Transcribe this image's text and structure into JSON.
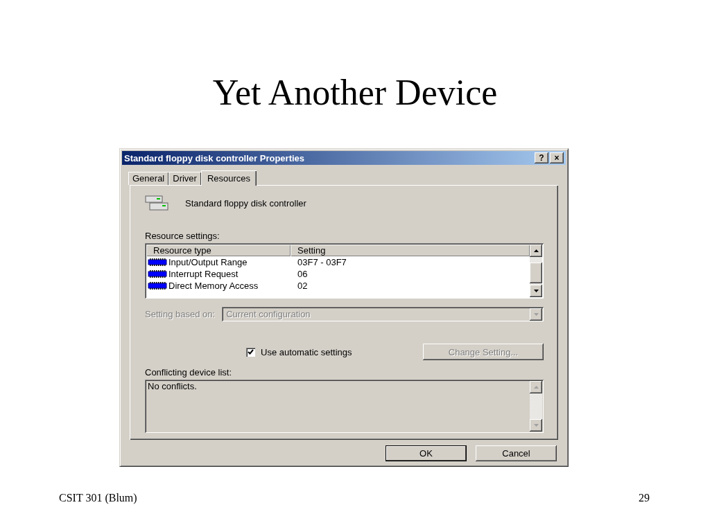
{
  "slide": {
    "title": "Yet Another Device",
    "footer_left": "CSIT 301 (Blum)",
    "page_number": "29"
  },
  "window": {
    "title": "Standard floppy disk controller Properties",
    "title_buttons": [
      "?",
      "×"
    ]
  },
  "tabs": [
    {
      "label": "General",
      "selected": false
    },
    {
      "label": "Driver",
      "selected": false
    },
    {
      "label": "Resources",
      "selected": true
    }
  ],
  "device_name": "Standard floppy disk controller",
  "resources": {
    "label": "Resource settings:",
    "columns": [
      "Resource type",
      "Setting"
    ],
    "rows": [
      {
        "type": "Input/Output Range",
        "setting": "03F7 - 03F7"
      },
      {
        "type": "Interrupt Request",
        "setting": "06"
      },
      {
        "type": "Direct Memory Access",
        "setting": "02"
      }
    ]
  },
  "setting_based_on": {
    "label": "Setting based on:",
    "value": "Current configuration",
    "disabled": true
  },
  "automatic": {
    "label": "Use automatic settings",
    "checked": true
  },
  "change_button": {
    "label": "Change Setting...",
    "disabled": true
  },
  "conflicts": {
    "label": "Conflicting device list:",
    "text": "No conflicts."
  },
  "buttons": [
    "OK",
    "Cancel"
  ]
}
